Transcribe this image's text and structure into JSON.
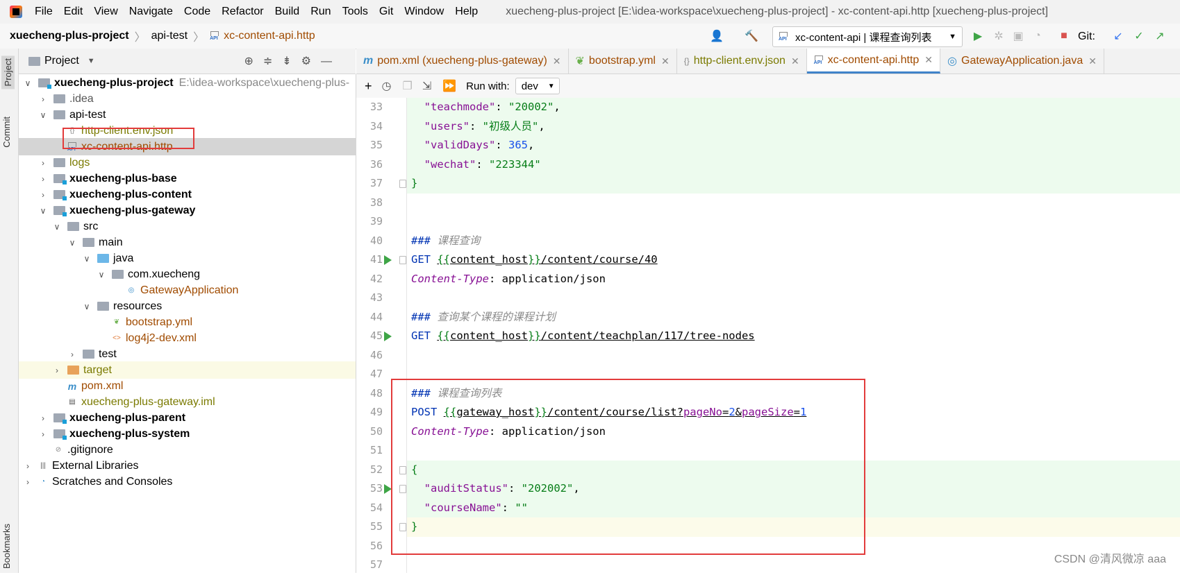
{
  "menu": {
    "items": [
      "File",
      "Edit",
      "View",
      "Navigate",
      "Code",
      "Refactor",
      "Build",
      "Run",
      "Tools",
      "Git",
      "Window",
      "Help"
    ],
    "window_title": "xuecheng-plus-project [E:\\idea-workspace\\xuecheng-plus-project] - xc-content-api.http [xuecheng-plus-project]"
  },
  "breadcrumb": {
    "project": "xuecheng-plus-project",
    "folder": "api-test",
    "file": "xc-content-api.http",
    "api_badge": "API"
  },
  "toolbar": {
    "run_config": "xc-content-api | 课程查询列表",
    "git_label": "Git:"
  },
  "side_tabs": {
    "project": "Project",
    "commit": "Commit",
    "bookmarks": "Bookmarks"
  },
  "project_panel": {
    "title": "Project",
    "tree": [
      {
        "label": "xuecheng-plus-project",
        "path": "E:\\idea-workspace\\xuecheng-plus-"
      },
      {
        "label": ".idea"
      },
      {
        "label": "api-test"
      },
      {
        "label": "http-client.env.json"
      },
      {
        "label": "xc-content-api.http"
      },
      {
        "label": "logs"
      },
      {
        "label": "xuecheng-plus-base"
      },
      {
        "label": "xuecheng-plus-content"
      },
      {
        "label": "xuecheng-plus-gateway"
      },
      {
        "label": "src"
      },
      {
        "label": "main"
      },
      {
        "label": "java"
      },
      {
        "label": "com.xuecheng"
      },
      {
        "label": "GatewayApplication"
      },
      {
        "label": "resources"
      },
      {
        "label": "bootstrap.yml"
      },
      {
        "label": "log4j2-dev.xml"
      },
      {
        "label": "test"
      },
      {
        "label": "target"
      },
      {
        "label": "pom.xml"
      },
      {
        "label": "xuecheng-plus-gateway.iml"
      },
      {
        "label": "xuecheng-plus-parent"
      },
      {
        "label": "xuecheng-plus-system"
      },
      {
        "label": ".gitignore"
      },
      {
        "label": "External Libraries"
      },
      {
        "label": "Scratches and Consoles"
      }
    ]
  },
  "tabs": [
    {
      "label": "pom.xml (xuecheng-plus-gateway)"
    },
    {
      "label": "bootstrap.yml"
    },
    {
      "label": "http-client.env.json"
    },
    {
      "label": "xc-content-api.http",
      "active": true
    },
    {
      "label": "GatewayApplication.java"
    }
  ],
  "editor_toolbar": {
    "run_with_label": "Run with:",
    "env_value": "dev"
  },
  "editor": {
    "line_numbers": [
      "33",
      "34",
      "35",
      "36",
      "37",
      "38",
      "39",
      "40",
      "41",
      "42",
      "43",
      "44",
      "45",
      "46",
      "47",
      "48",
      "49",
      "50",
      "51",
      "52",
      "53",
      "54",
      "55",
      "56",
      "57"
    ],
    "lines": {
      "l33_key": "\"teachmode\"",
      "l33_val": "\"20002\"",
      "l34_key": "\"users\"",
      "l34_val": "\"初级人员\"",
      "l35_key": "\"validDays\"",
      "l35_val": "365",
      "l36_key": "\"wechat\"",
      "l36_val": "\"223344\"",
      "l37": "}",
      "l40_comment": "课程查询",
      "l41_method": "GET",
      "l41_var": "content_host",
      "l41_path": "/content/course/40",
      "l42_header": "Content-Type",
      "l42_value": "application/json",
      "l44_comment": "查询某个课程的课程计划",
      "l45_method": "GET",
      "l45_var": "content_host",
      "l45_path": "/content/teachplan/117/tree-nodes",
      "l48_comment": "课程查询列表",
      "l49_method": "POST",
      "l49_var": "gateway_host",
      "l49_path": "/content/course/list?",
      "l49_p1": "pageNo",
      "l49_v1": "2",
      "l49_p2": "pageSize",
      "l49_v2": "1",
      "l50_header": "Content-Type",
      "l50_value": "application/json",
      "l52": "{",
      "l53_key": "\"auditStatus\"",
      "l53_val": "\"202002\"",
      "l54_key": "\"courseName\"",
      "l54_val": "\"\"",
      "l55": "}",
      "hash": "###"
    }
  },
  "watermark": "CSDN @清风微凉 aaa"
}
